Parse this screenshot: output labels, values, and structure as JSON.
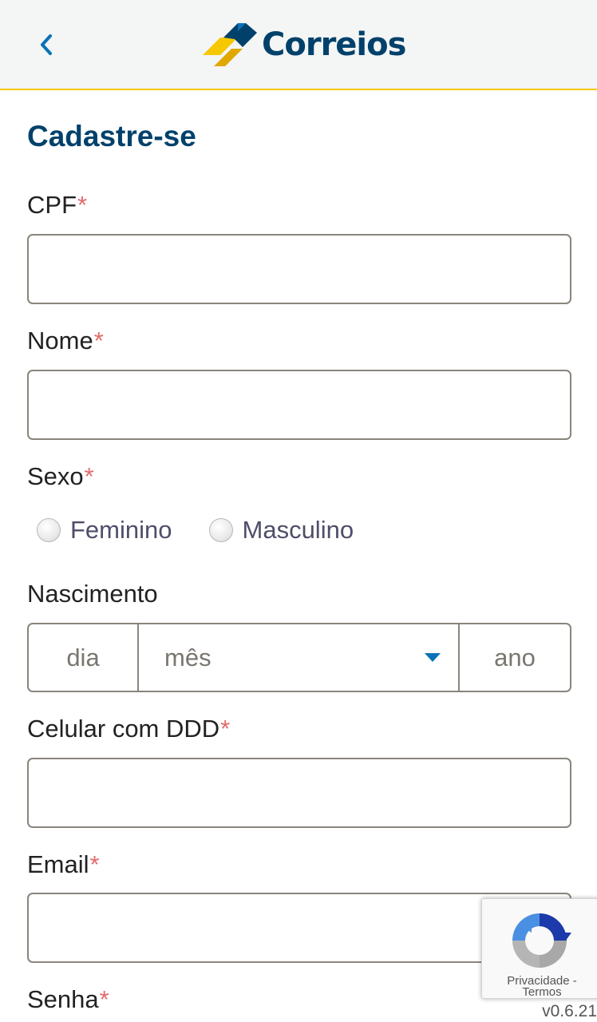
{
  "header": {
    "back_icon": "chevron-left-icon",
    "logo_text": "Correios",
    "colors": {
      "brand_blue": "#00416b",
      "brand_yellow": "#f5c800",
      "accent_blue": "#0a72b8"
    }
  },
  "form": {
    "title": "Cadastre-se",
    "required_mark": "*",
    "cpf": {
      "label": "CPF",
      "value": ""
    },
    "nome": {
      "label": "Nome",
      "value": ""
    },
    "sexo": {
      "label": "Sexo",
      "options": [
        {
          "label": "Feminino",
          "selected": false
        },
        {
          "label": "Masculino",
          "selected": false
        }
      ]
    },
    "nascimento": {
      "label": "Nascimento",
      "day_placeholder": "dia",
      "month_placeholder": "mês",
      "year_placeholder": "ano"
    },
    "celular": {
      "label": "Celular com DDD",
      "value": ""
    },
    "email": {
      "label": "Email",
      "value": ""
    },
    "senha": {
      "label": "Senha"
    }
  },
  "recaptcha": {
    "privacy_link": "Privacidade",
    "separator": " - ",
    "terms_link": "Termos"
  },
  "version": "v0.6.21"
}
